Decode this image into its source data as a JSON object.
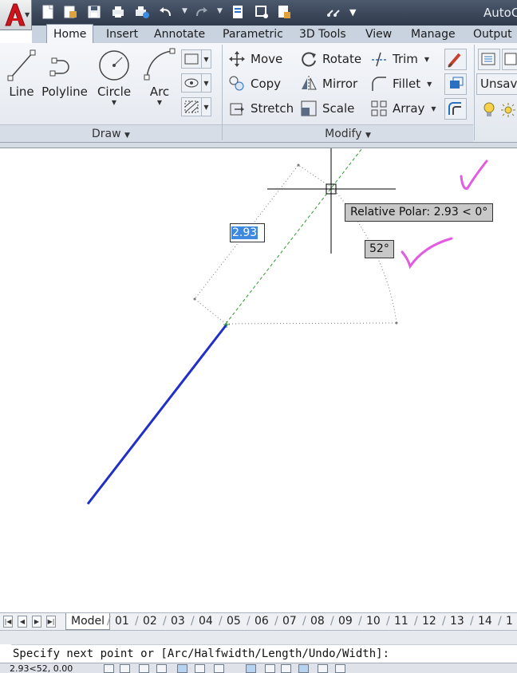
{
  "app": {
    "title": "AutoC"
  },
  "ribbon_tabs": [
    {
      "label": "Home",
      "active": true
    },
    {
      "label": "Insert"
    },
    {
      "label": "Annotate"
    },
    {
      "label": "Parametric"
    },
    {
      "label": "3D Tools"
    },
    {
      "label": "View"
    },
    {
      "label": "Manage"
    },
    {
      "label": "Output"
    }
  ],
  "draw_panel": {
    "title": "Draw",
    "line": "Line",
    "polyline": "Polyline",
    "circle": "Circle",
    "arc": "Arc"
  },
  "modify_panel": {
    "title": "Modify",
    "move": "Move",
    "rotate": "Rotate",
    "trim": "Trim",
    "copy": "Copy",
    "mirror": "Mirror",
    "fillet": "Fillet",
    "stretch": "Stretch",
    "scale": "Scale",
    "array": "Array"
  },
  "layers_panel": {
    "layer_state": "Unsave"
  },
  "drawing": {
    "length_input": "2.93",
    "polar_tooltip": "Relative Polar: 2.93 < 0°",
    "angle_tooltip": "52°",
    "polyline_color": "#1f2fc8",
    "tracking_color": "#2e9a2e",
    "annotation_color": "#e25be0"
  },
  "layout_tabs": [
    "Model",
    "01",
    "02",
    "03",
    "04",
    "05",
    "06",
    "07",
    "08",
    "09",
    "10",
    "11",
    "12",
    "13",
    "14",
    "1"
  ],
  "command_line": {
    "prompt": "Specify next point or [Arc/Halfwidth/Length/Undo/Width]:"
  },
  "status": {
    "coordinates": "2.93<52, 0.00"
  }
}
